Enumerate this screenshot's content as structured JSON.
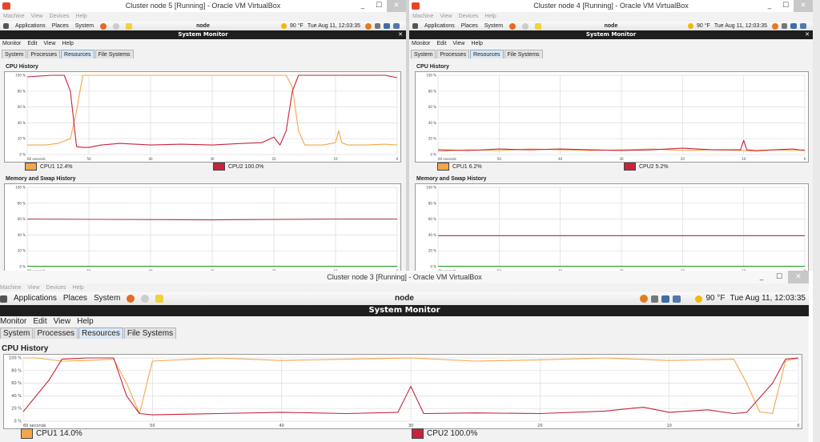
{
  "colors": {
    "cpu1": "#f3a64a",
    "cpu2": "#c7233c",
    "mem": "#b4414d",
    "swap": "#1ea01e",
    "grid": "#dcdcdc"
  },
  "icons": [
    "virtualbox-icon",
    "foot-icon",
    "firefox-icon",
    "help-icon",
    "notes-icon",
    "weather-sun-icon",
    "volume-icon",
    "network-icon",
    "minimize-icon",
    "maximize-icon",
    "close-icon"
  ],
  "vbox_menu": [
    "Machine",
    "View",
    "Devices",
    "Help"
  ],
  "gnome_menu": [
    "Applications",
    "Places",
    "System"
  ],
  "app_menu": [
    "Monitor",
    "Edit",
    "View",
    "Help"
  ],
  "tabs": [
    "System",
    "Processes",
    "Resources",
    "File Systems"
  ],
  "active_tab": 2,
  "weather": "90 °F",
  "host": "node",
  "app_title": "System Monitor",
  "cpu_history_label": "CPU History",
  "mem_history_label": "Memory and Swap History",
  "winbtn": {
    "min": "_",
    "max": "☐",
    "close": "✕"
  },
  "windows": [
    {
      "title": "Cluster node 5 [Running] - Oracle VM VirtualBox",
      "clock": "Tue Aug 11, 12:03:35",
      "cpu1_label": "CPU1 12.4%",
      "cpu2_label": "CPU2 100.0%"
    },
    {
      "title": "Cluster node 4 [Running] - Oracle VM VirtualBox",
      "clock": "Tue Aug 11, 12:03:35",
      "cpu1_label": "CPU1 6.2%",
      "cpu2_label": "CPU2 5.2%"
    },
    {
      "title": "Cluster node 3 [Running] - Oracle VM VirtualBox",
      "clock": "Tue Aug 11, 12:03:35",
      "cpu1_label": "CPU1 14.0%",
      "cpu2_label": "CPU2 100.0%"
    }
  ],
  "chart_data": [
    {
      "type": "line",
      "title": "CPU History (Cluster node 5)",
      "x_ticks": [
        "60 seconds",
        "50",
        "40",
        "30",
        "20",
        "10",
        "0"
      ],
      "y_ticks": [
        "100 %",
        "80 %",
        "60 %",
        "40 %",
        "20 %",
        "0 %"
      ],
      "xlim": [
        60,
        0
      ],
      "ylim": [
        0,
        100
      ],
      "series": [
        {
          "name": "CPU1",
          "x": [
            60,
            57,
            55,
            53,
            52,
            51,
            50,
            45,
            40,
            35,
            30,
            25,
            20,
            19,
            18,
            17,
            16,
            15,
            12,
            10,
            9.5,
            9,
            8,
            5,
            2,
            0
          ],
          "y": [
            12,
            12,
            14,
            20,
            55,
            100,
            100,
            100,
            100,
            100,
            100,
            100,
            100,
            100,
            100,
            85,
            30,
            12,
            12,
            15,
            30,
            15,
            12,
            12,
            13,
            12
          ]
        },
        {
          "name": "CPU2",
          "x": [
            60,
            56,
            54,
            53,
            52,
            51,
            50,
            48,
            45,
            40,
            35,
            30,
            25,
            22,
            20,
            19,
            18,
            17,
            16,
            15,
            12,
            9,
            5,
            2,
            0
          ],
          "y": [
            98,
            100,
            100,
            80,
            10,
            9,
            9,
            12,
            14,
            12,
            13,
            12,
            14,
            15,
            22,
            12,
            30,
            80,
            100,
            100,
            100,
            100,
            100,
            100,
            97
          ]
        }
      ]
    },
    {
      "type": "line",
      "title": "Memory and Swap History (Cluster node 5)",
      "x_ticks": [
        "60 seconds",
        "50",
        "40",
        "30",
        "20",
        "10",
        "0"
      ],
      "y_ticks": [
        "100 %",
        "80 %",
        "60 %",
        "40 %",
        "20 %",
        "0 %"
      ],
      "xlim": [
        60,
        0
      ],
      "ylim": [
        0,
        100
      ],
      "series": [
        {
          "name": "Memory",
          "x": [
            60,
            30,
            10,
            0
          ],
          "y": [
            60,
            59,
            60,
            60
          ]
        },
        {
          "name": "Swap",
          "x": [
            60,
            0
          ],
          "y": [
            0.5,
            0.5
          ]
        }
      ]
    },
    {
      "type": "line",
      "title": "CPU History (Cluster node 4)",
      "x_ticks": [
        "60 seconds",
        "50",
        "40",
        "30",
        "20",
        "10",
        "0"
      ],
      "y_ticks": [
        "100 %",
        "80 %",
        "60 %",
        "40 %",
        "20 %",
        "0 %"
      ],
      "xlim": [
        60,
        0
      ],
      "ylim": [
        0,
        100
      ],
      "series": [
        {
          "name": "CPU1",
          "x": [
            60,
            55,
            50,
            45,
            40,
            35,
            30,
            25,
            20,
            15,
            10,
            8,
            5,
            2,
            0
          ],
          "y": [
            4,
            6,
            5,
            7,
            6,
            5,
            6,
            7,
            5,
            6,
            5,
            4,
            6,
            5,
            6
          ]
        },
        {
          "name": "CPU2",
          "x": [
            60,
            55,
            50,
            45,
            40,
            35,
            30,
            25,
            20,
            15,
            10.5,
            10,
            9.5,
            8,
            5,
            2,
            0
          ],
          "y": [
            6,
            5,
            7,
            6,
            7,
            6,
            5,
            6,
            8,
            6,
            6,
            18,
            6,
            5,
            6,
            7,
            5
          ]
        }
      ]
    },
    {
      "type": "line",
      "title": "Memory and Swap History (Cluster node 4)",
      "x_ticks": [
        "60 seconds",
        "50",
        "40",
        "30",
        "20",
        "10",
        "0"
      ],
      "y_ticks": [
        "100 %",
        "80 %",
        "60 %",
        "40 %",
        "20 %",
        "0 %"
      ],
      "xlim": [
        60,
        0
      ],
      "ylim": [
        0,
        100
      ],
      "series": [
        {
          "name": "Memory",
          "x": [
            60,
            0
          ],
          "y": [
            39,
            39
          ]
        },
        {
          "name": "Swap",
          "x": [
            60,
            0
          ],
          "y": [
            0.5,
            0.5
          ]
        }
      ]
    },
    {
      "type": "line",
      "title": "CPU History (Cluster node 3)",
      "x_ticks": [
        "60 seconds",
        "50",
        "40",
        "30",
        "20",
        "10",
        "0"
      ],
      "y_ticks": [
        "100 %",
        "80 %",
        "60 %",
        "40 %",
        "20 %",
        "0 %"
      ],
      "xlim": [
        60,
        0
      ],
      "ylim": [
        0,
        100
      ],
      "series": [
        {
          "name": "CPU1",
          "x": [
            60,
            59,
            57,
            55,
            53,
            52,
            51,
            50,
            45,
            40,
            35,
            30,
            25,
            20,
            15,
            10,
            5,
            4,
            3,
            2,
            1,
            0
          ],
          "y": [
            100,
            100,
            95,
            96,
            98,
            60,
            12,
            95,
            100,
            96,
            98,
            100,
            95,
            97,
            100,
            96,
            98,
            60,
            15,
            12,
            95,
            100
          ]
        },
        {
          "name": "CPU2",
          "x": [
            60,
            59,
            58,
            57,
            55,
            53,
            52,
            51,
            50,
            45,
            40,
            35,
            31,
            30,
            29,
            25,
            20,
            15,
            12,
            10,
            7,
            5,
            4,
            2,
            1,
            0
          ],
          "y": [
            15,
            40,
            65,
            98,
            100,
            100,
            40,
            12,
            10,
            12,
            14,
            12,
            14,
            55,
            12,
            13,
            12,
            16,
            22,
            14,
            18,
            12,
            14,
            60,
            98,
            100
          ]
        }
      ]
    }
  ]
}
